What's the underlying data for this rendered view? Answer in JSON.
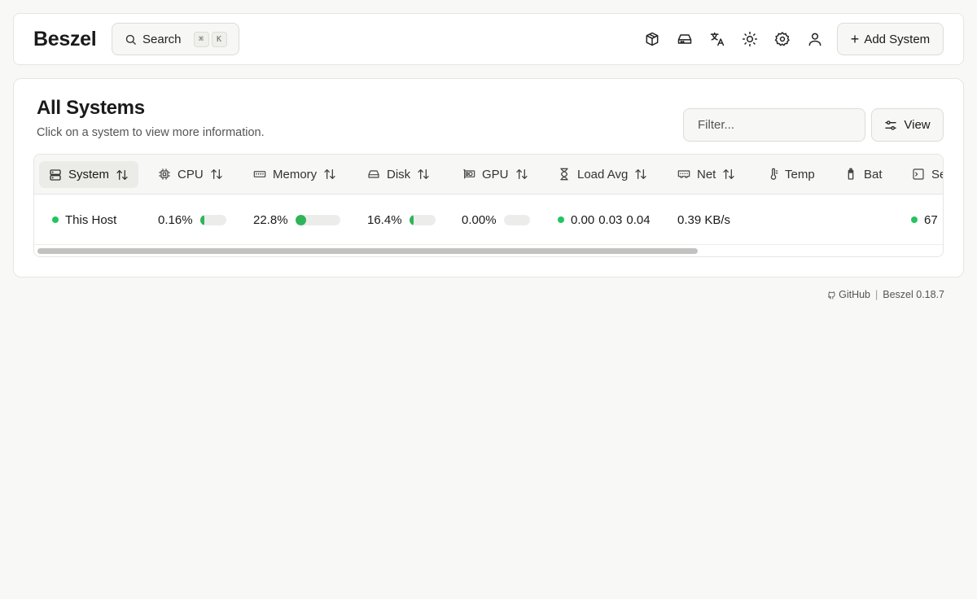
{
  "app": {
    "logo": "Beszel"
  },
  "header": {
    "search_label": "Search",
    "search_keys": [
      "⌘",
      "K"
    ],
    "add_system_label": "Add System",
    "icons": [
      "containers-icon",
      "storage-icon",
      "language-icon",
      "theme-sun-icon",
      "settings-gear-icon",
      "user-icon"
    ]
  },
  "main": {
    "title": "All Systems",
    "subtitle": "Click on a system to view more information.",
    "filter_placeholder": "Filter...",
    "view_label": "View"
  },
  "table": {
    "columns": [
      {
        "label": "System",
        "icon": "server-icon",
        "sortable": true
      },
      {
        "label": "CPU",
        "icon": "cpu-icon",
        "sortable": true
      },
      {
        "label": "Memory",
        "icon": "memory-icon",
        "sortable": true
      },
      {
        "label": "Disk",
        "icon": "disk-icon",
        "sortable": true
      },
      {
        "label": "GPU",
        "icon": "gpu-icon",
        "sortable": true
      },
      {
        "label": "Load Avg",
        "icon": "hourglass-icon",
        "sortable": true
      },
      {
        "label": "Net",
        "icon": "network-icon",
        "sortable": true
      },
      {
        "label": "Temp",
        "icon": "thermometer-icon",
        "sortable": false
      },
      {
        "label": "Bat",
        "icon": "battery-icon",
        "sortable": false
      },
      {
        "label": "Se",
        "icon": "services-icon",
        "sortable": false
      }
    ],
    "rows": [
      {
        "system": "This Host",
        "status_color": "#22c55e",
        "cpu": "0.16%",
        "cpu_pct": 0.16,
        "memory": "22.8%",
        "memory_pct": 22.8,
        "disk": "16.4%",
        "disk_pct": 16.4,
        "gpu": "0.00%",
        "gpu_pct": 0,
        "load_avg": [
          "0.00",
          "0.03",
          "0.04"
        ],
        "net": "0.39 KB/s",
        "services": "67"
      }
    ]
  },
  "footer": {
    "github_label": "GitHub",
    "version_label": "Beszel 0.18.7"
  },
  "colors": {
    "status_up": "#22c55e",
    "bar_fill": "#2fb45a"
  }
}
